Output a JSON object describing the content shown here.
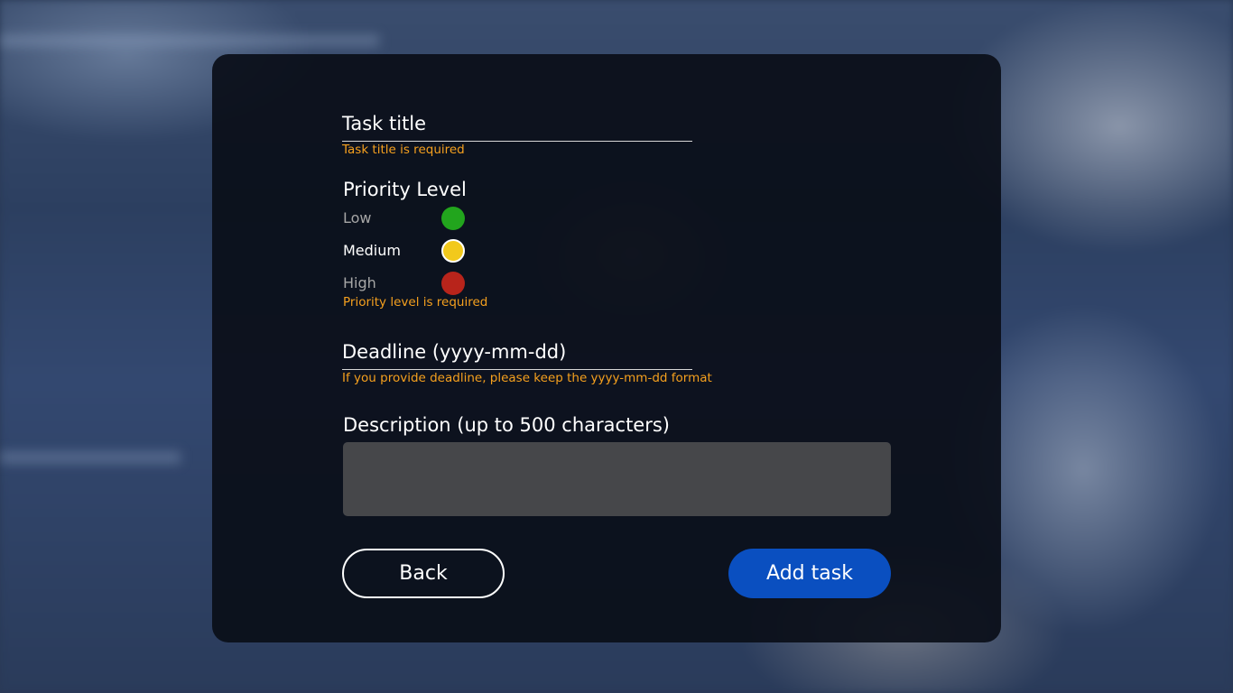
{
  "form": {
    "task_title": {
      "label": "Task title",
      "error": "Task title is required"
    },
    "priority": {
      "title": "Priority Level",
      "options": [
        {
          "label": "Low",
          "color": "#22a51d",
          "selected": false
        },
        {
          "label": "Medium",
          "color": "#f2c91c",
          "selected": true
        },
        {
          "label": "High",
          "color": "#b8241b",
          "selected": false
        }
      ],
      "error": "Priority level is required"
    },
    "deadline": {
      "label": "Deadline (yyyy-mm-dd)",
      "error": "If you provide deadline, please keep the yyyy-mm-dd format"
    },
    "description": {
      "label": "Description (up to 500 characters)",
      "value": ""
    }
  },
  "actions": {
    "back_label": "Back",
    "add_label": "Add task"
  },
  "colors": {
    "accent": "#0a4fc0",
    "error": "#f5a01e"
  }
}
